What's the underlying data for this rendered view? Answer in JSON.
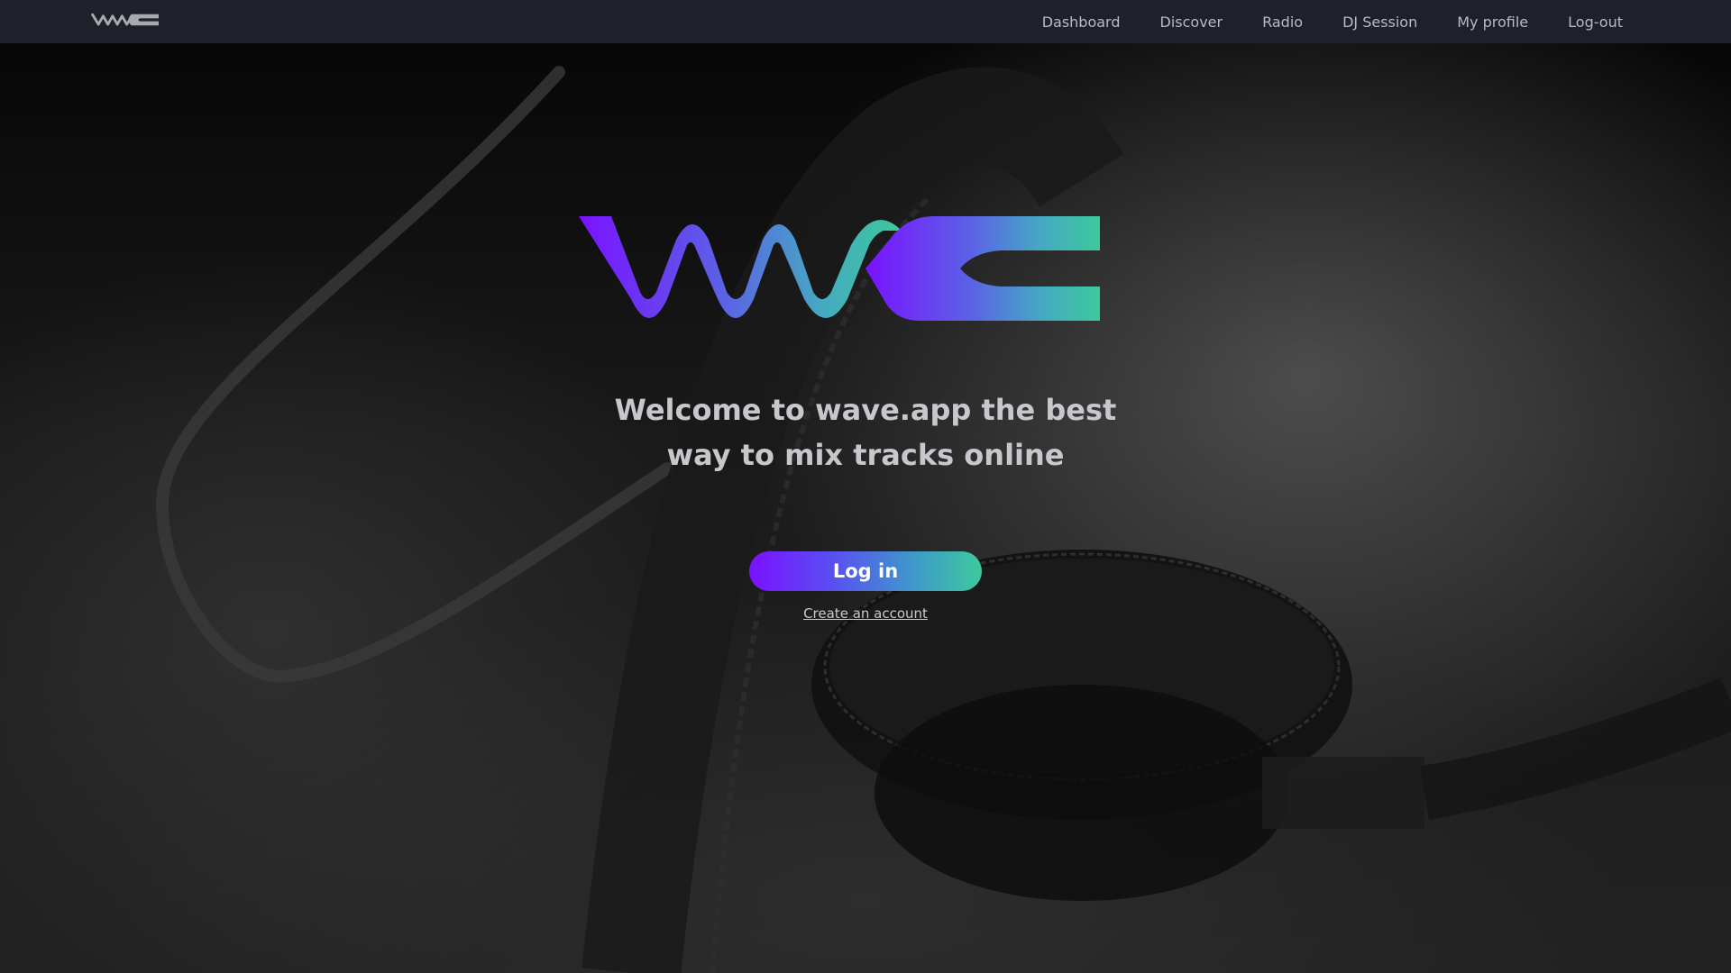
{
  "nav": {
    "logo_icon": "wave-logo-icon",
    "items": [
      {
        "label": "Dashboard"
      },
      {
        "label": "Discover"
      },
      {
        "label": "Radio"
      },
      {
        "label": "DJ Session"
      },
      {
        "label": "My profile"
      },
      {
        "label": "Log-out"
      }
    ]
  },
  "hero": {
    "logo_icon": "wave-logo-icon",
    "headline_line1": "Welcome to wave.app the best",
    "headline_line2": "way to mix tracks online",
    "login_label": "Log in",
    "create_account_label": "Create an account"
  },
  "colors": {
    "navbar_bg": "#1f2029",
    "brand_purple": "#7a12ff",
    "brand_teal": "#3dc99c"
  }
}
